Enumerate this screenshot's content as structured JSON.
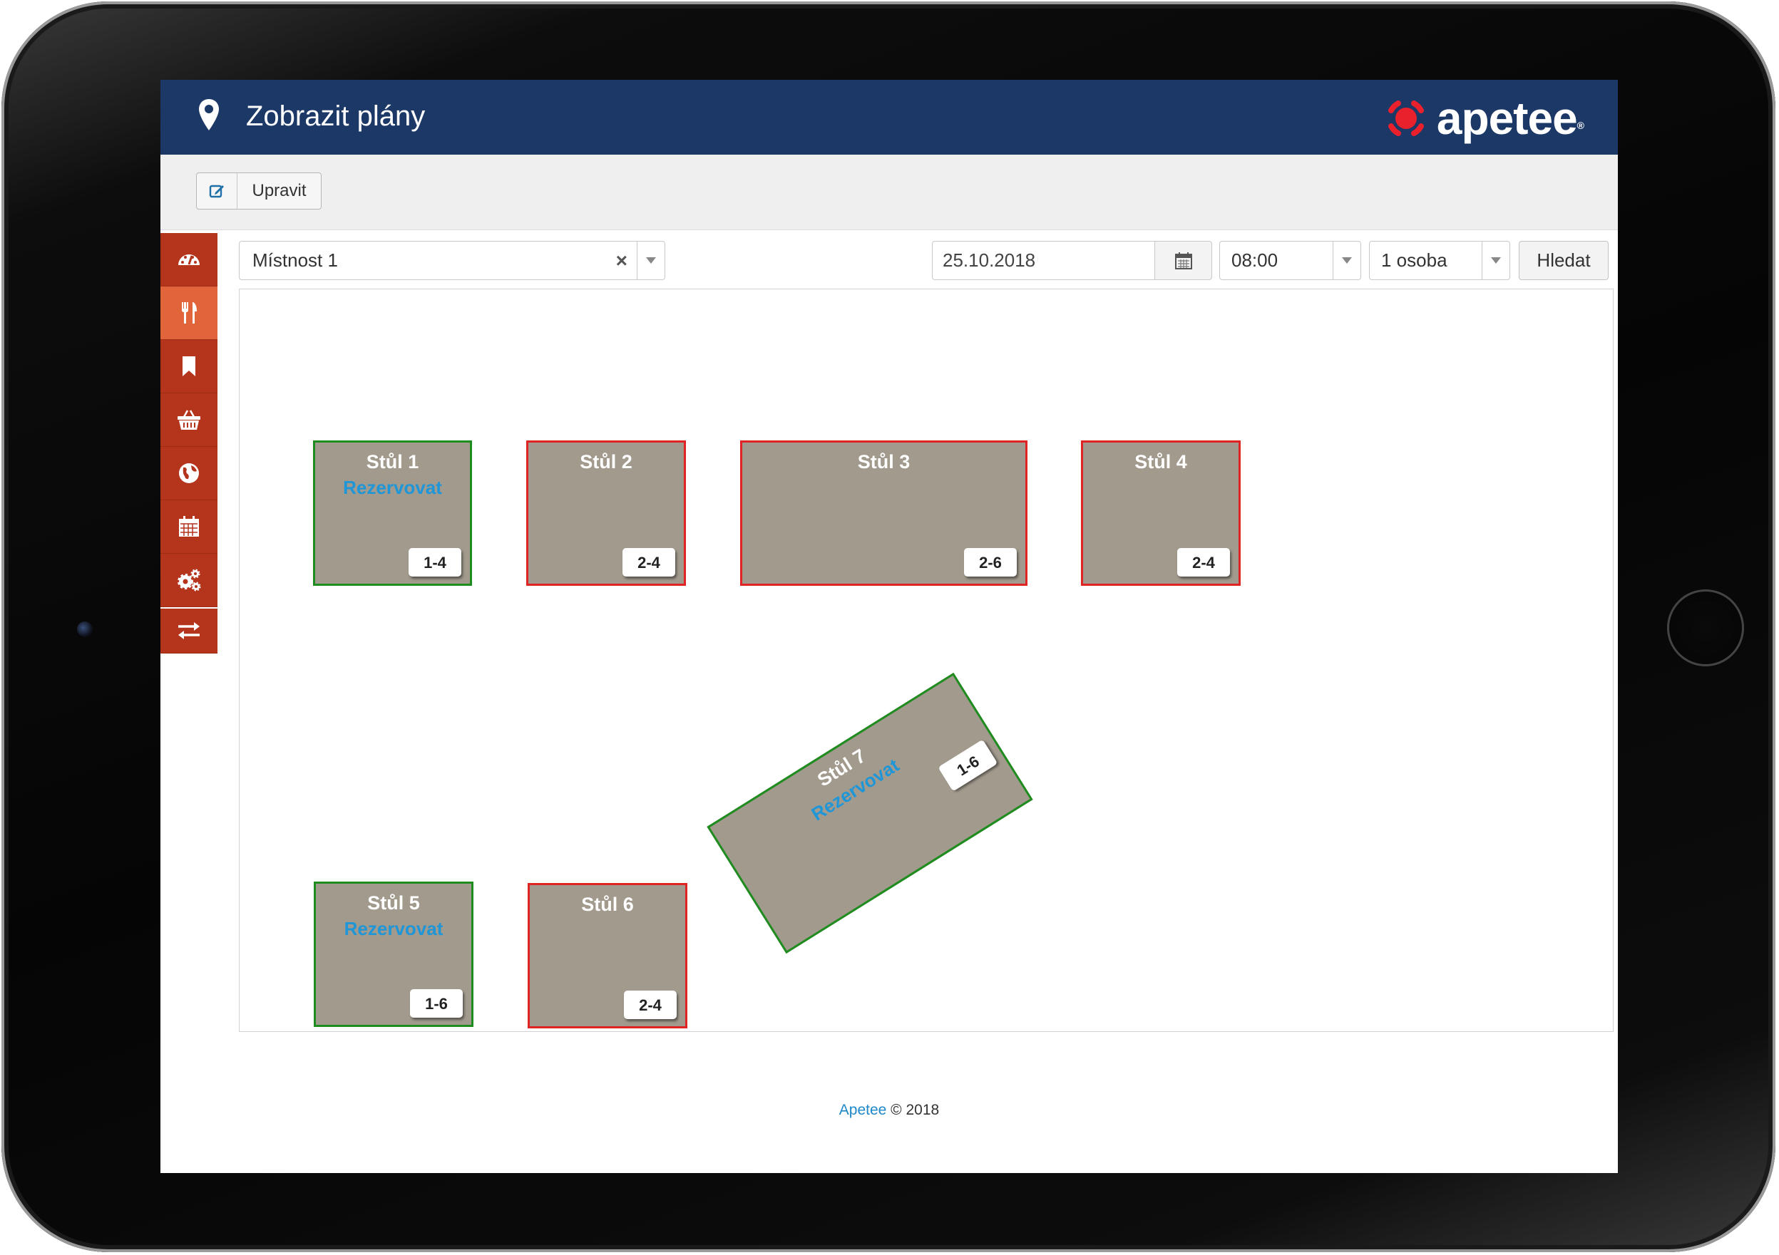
{
  "header": {
    "title": "Zobrazit plány",
    "logo_text": "apetee",
    "logo_mark": "®"
  },
  "toolbar": {
    "edit_label": "Upravit"
  },
  "sidebar": {
    "items": [
      {
        "icon": "dashboard-icon"
      },
      {
        "icon": "cutlery-icon",
        "active": true
      },
      {
        "icon": "bookmark-icon"
      },
      {
        "icon": "basket-icon"
      },
      {
        "icon": "globe-icon"
      },
      {
        "icon": "calendar-icon"
      },
      {
        "icon": "settings-icon"
      },
      {
        "icon": "swap-icon"
      }
    ]
  },
  "filters": {
    "room": "Místnost 1",
    "clear_symbol": "×",
    "date": "25.10.2018",
    "time": "08:00",
    "persons": "1 osoba",
    "search_label": "Hledat"
  },
  "tables": [
    {
      "name": "Stůl 1",
      "capacity": "1-4",
      "status": "free",
      "reserve_label": "Rezervovat"
    },
    {
      "name": "Stůl 2",
      "capacity": "2-4",
      "status": "busy"
    },
    {
      "name": "Stůl 3",
      "capacity": "2-6",
      "status": "busy"
    },
    {
      "name": "Stůl 4",
      "capacity": "2-4",
      "status": "busy"
    },
    {
      "name": "Stůl 5",
      "capacity": "1-6",
      "status": "free",
      "reserve_label": "Rezervovat"
    },
    {
      "name": "Stůl 6",
      "capacity": "2-4",
      "status": "busy"
    },
    {
      "name": "Stůl 7",
      "capacity": "1-6",
      "status": "free",
      "reserve_label": "Rezervovat"
    }
  ],
  "colors": {
    "header": "#1c3867",
    "sidebar": "#b4341c",
    "sidebar_active": "#e2643a",
    "table_fill": "#a19a8d",
    "free_border": "#1f8c1f",
    "busy_border": "#e02424",
    "reserve_text": "#1e96d8"
  },
  "footer": {
    "brand": "Apetee",
    "copyright": " © 2018"
  }
}
